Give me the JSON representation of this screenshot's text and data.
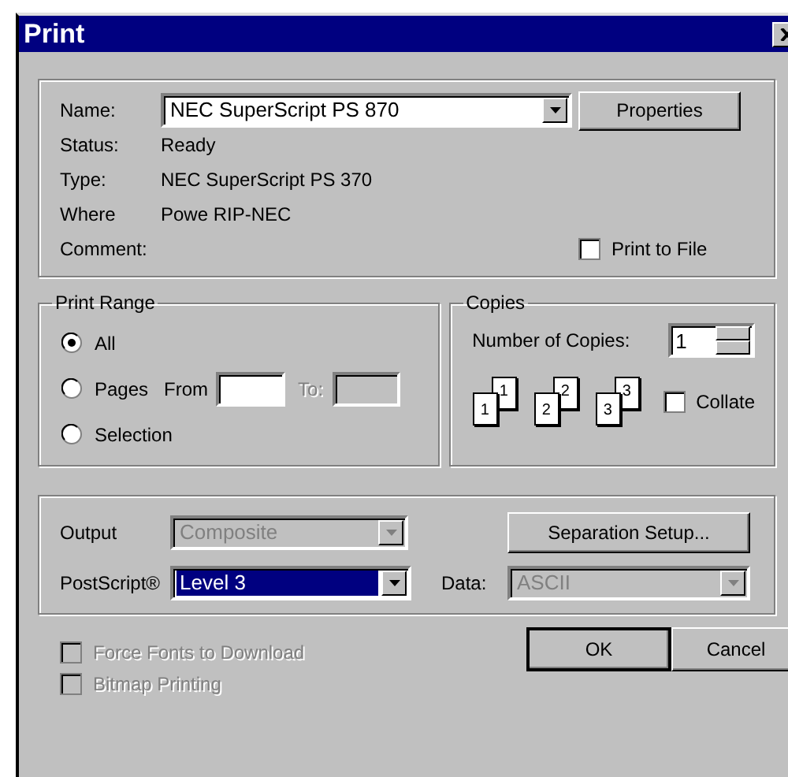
{
  "window": {
    "title": "Print"
  },
  "printer": {
    "fields": [
      {
        "kind": "combo",
        "label": "Name:",
        "value": "NEC SuperScript PS 870"
      },
      {
        "kind": "text",
        "label": "Status:",
        "value": "Ready"
      },
      {
        "kind": "text",
        "label": "Type:",
        "value": "NEC SuperScript PS 370"
      },
      {
        "kind": "text",
        "label": "Where",
        "value": "Powe RIP-NEC"
      },
      {
        "kind": "text",
        "label": "Comment:"
      }
    ],
    "properties_button": "Properties",
    "print_to_file": {
      "label": "Print to File",
      "checked": false
    }
  },
  "print_range": {
    "title": "Print Range",
    "options": [
      {
        "label": "All",
        "selected": true
      },
      {
        "label": "Pages",
        "selected": false
      },
      {
        "label": "Selection",
        "selected": false
      }
    ],
    "from_label": "From",
    "to_label": "To:",
    "to_disabled": true
  },
  "copies": {
    "title": "Copies",
    "number_label": "Number of Copies:",
    "number": "1",
    "page_stacks": [
      {
        "back": "1",
        "front": "1"
      },
      {
        "back": "2",
        "front": "2"
      },
      {
        "back": "3",
        "front": "3"
      }
    ],
    "collate": {
      "label": "Collate",
      "checked": false
    }
  },
  "output": {
    "output": {
      "label": "Output",
      "value": "Composite",
      "disabled": true,
      "highlighted": false
    },
    "postscript": {
      "label": "PostScript®",
      "value": "Level 3",
      "disabled": false,
      "highlighted": true
    },
    "data": {
      "label": "Data:",
      "value": "ASCII",
      "disabled": true,
      "highlighted": false
    },
    "separation_button": "Separation Setup..."
  },
  "options": [
    {
      "label": "Force Fonts to Download",
      "checked": false,
      "disabled": true
    },
    {
      "label": "Bitmap Printing",
      "checked": false,
      "disabled": true
    }
  ],
  "buttons": [
    {
      "label": "OK",
      "default": true
    },
    {
      "label": "Cancel",
      "default": false
    }
  ]
}
